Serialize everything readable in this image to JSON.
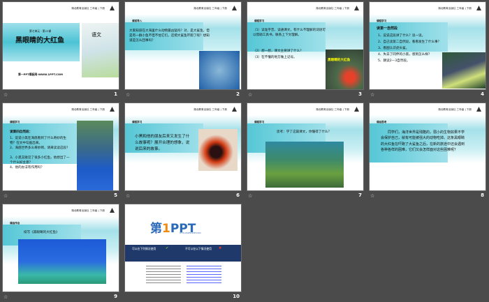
{
  "header": "湖北教育出版社 三年级 | 下册",
  "slides": [
    {
      "num": "1",
      "unit": "第七单元 · 第23课",
      "title": "黑眼睛的大红鱼",
      "site": "第一PPT模板网-WWW.1PPT.COM",
      "book": "语文"
    },
    {
      "num": "2",
      "label": "课前导入",
      "text": "大家知道在大海里什么动物最凶猛吗？对，是大鲨鱼，但是有一群小鱼不但不怕它们，还把大鲨鱼吓跑了呢？想知道是怎么回事吗？"
    },
    {
      "num": "3",
      "label": "课程学习",
      "lines": [
        "（1）读准字音，读通课文，有什么不理解的词语可以借助工具书，联系上下文理解。",
        "（2）想一想，课文主要讲了什么？",
        "（3）在不懂的地方做上记号。"
      ],
      "caption": "黑眼睛的大红鱼"
    },
    {
      "num": "4",
      "label": "课程学习",
      "heading": "读第一自然段",
      "lines": [
        "1、说说这段讲了什么？读一读。",
        "2、自己读第二自然段，看看发生了什么事？",
        "3、看图认识虎头鲨。",
        "4、失去了同伴的小黑，感到怎么样？",
        "5、朗读2—3自然段。"
      ]
    },
    {
      "num": "5",
      "label": "课程学习",
      "heading": "读第四自然段：",
      "lines": [
        "1、说说小黑在海底看到了什么奇妙的生物？在文中勾画出来。",
        "2、海底世界多么奇妙啊，请来读读这段？",
        "3、小黑又碰见了很多小红鱼，他想出了一个什么好主意？",
        "4、他的办法有作用吗？"
      ]
    },
    {
      "num": "6",
      "label": "课程学习",
      "text": "小黑和他的朋友后来又发生了什么故事呢？展开合理的想象，说说后来的故事。"
    },
    {
      "num": "7",
      "label": "课程学习",
      "text": "思考：学了这篇课文，你懂得了什么？"
    },
    {
      "num": "8",
      "label": "课后思考",
      "text": "同学们，海洋世界是残酷的，弱小的生物如果不学会保护自己，就有可能被强大的动物吃掉。这条黑眼睛的大红鱼在吓跑了大鲨鱼之后，在新的旅途中还会遇到各种各样的困难，它们又会怎样面对这些困难呢？"
    },
    {
      "num": "9",
      "label": "课后作业",
      "text": "续写《黑眼睛的大红鱼》"
    },
    {
      "num": "10",
      "brand_cn": "第",
      "brand_num": "1",
      "brand_en": "PPT",
      "url": "HTTP://WWW.1PPT.COM",
      "can": "可以在下列情况使用",
      "cannot": "不可以在以下情况使用"
    }
  ],
  "colors": {
    "accent": "#56c7d6",
    "bg": "#4b4b4b"
  }
}
